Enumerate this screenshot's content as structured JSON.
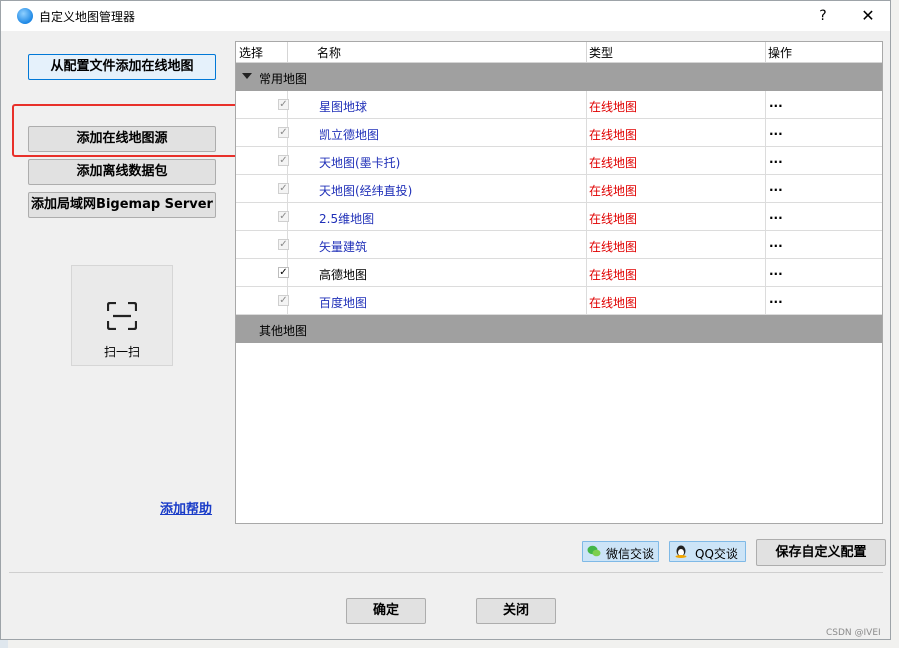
{
  "window": {
    "title": "自定义地图管理器",
    "help": "?",
    "close": "✕"
  },
  "left": {
    "add_from_config": "从配置文件添加在线地图",
    "add_online_source": "添加在线地图源",
    "add_offline_package": "添加离线数据包",
    "add_lan_server": "添加局域网Bigemap Server",
    "scan_label": "扫一扫",
    "help_link": "添加帮助"
  },
  "table": {
    "headers": [
      "选择",
      "名称",
      "类型",
      "操作"
    ],
    "group_common": "常用地图",
    "group_other": "其他地图",
    "rows": [
      {
        "checked": true,
        "enabled": false,
        "name": "星图地球",
        "type": "在线地图",
        "op": "..."
      },
      {
        "checked": true,
        "enabled": false,
        "name": "凯立德地图",
        "type": "在线地图",
        "op": "..."
      },
      {
        "checked": true,
        "enabled": false,
        "name": "天地图(墨卡托)",
        "type": "在线地图",
        "op": "..."
      },
      {
        "checked": true,
        "enabled": false,
        "name": "天地图(经纬直投)",
        "type": "在线地图",
        "op": "..."
      },
      {
        "checked": true,
        "enabled": false,
        "name": "2.5维地图",
        "type": "在线地图",
        "op": "..."
      },
      {
        "checked": true,
        "enabled": false,
        "name": "矢量建筑",
        "type": "在线地图",
        "op": "..."
      },
      {
        "checked": true,
        "enabled": true,
        "name": "高德地图",
        "type": "在线地图",
        "op": "..."
      },
      {
        "checked": true,
        "enabled": false,
        "name": "百度地图",
        "type": "在线地图",
        "op": "..."
      }
    ]
  },
  "bottom": {
    "wechat": "微信交谈",
    "qq": "QQ交谈",
    "save_config": "保存自定义配置",
    "ok": "确定",
    "close": "关闭"
  },
  "watermark": "CSDN @IVEI",
  "colors": {
    "link_blue": "#2030b8",
    "type_red": "#e00000",
    "highlight_red": "#e8302a",
    "group_gray": "#a0a0a0"
  }
}
